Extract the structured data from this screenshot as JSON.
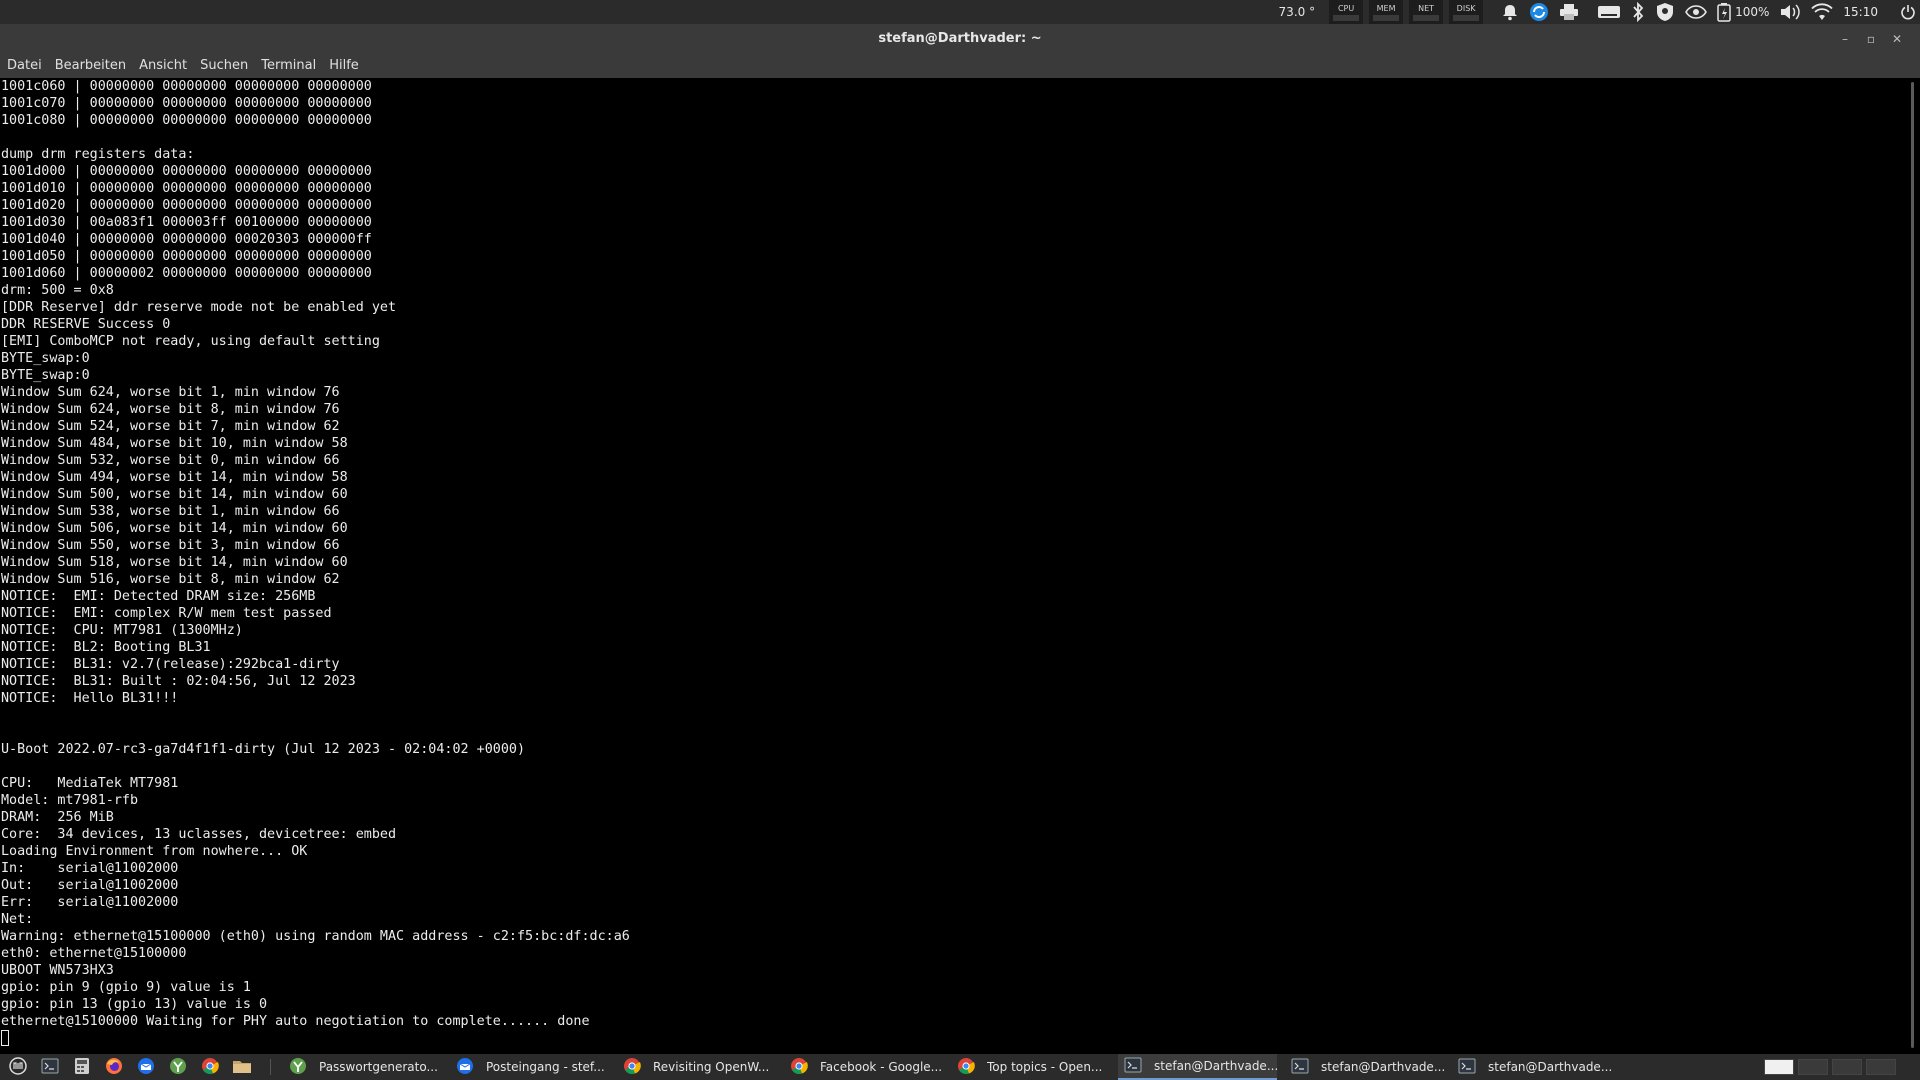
{
  "top_panel": {
    "temperature": "73.0 °",
    "monitors": [
      "CPU",
      "MEM",
      "NET",
      "DISK"
    ],
    "battery": "100%",
    "clock": "15:10"
  },
  "window": {
    "title": "stefan@Darthvader: ~"
  },
  "menu": [
    "Datei",
    "Bearbeiten",
    "Ansicht",
    "Suchen",
    "Terminal",
    "Hilfe"
  ],
  "terminal": {
    "lines": [
      "1001c060 | 00000000 00000000 00000000 00000000",
      "1001c070 | 00000000 00000000 00000000 00000000",
      "1001c080 | 00000000 00000000 00000000 00000000",
      "",
      "dump drm registers data:",
      "1001d000 | 00000000 00000000 00000000 00000000",
      "1001d010 | 00000000 00000000 00000000 00000000",
      "1001d020 | 00000000 00000000 00000000 00000000",
      "1001d030 | 00a083f1 000003ff 00100000 00000000",
      "1001d040 | 00000000 00000000 00020303 000000ff",
      "1001d050 | 00000000 00000000 00000000 00000000",
      "1001d060 | 00000002 00000000 00000000 00000000",
      "drm: 500 = 0x8",
      "[DDR Reserve] ddr reserve mode not be enabled yet",
      "DDR RESERVE Success 0",
      "[EMI] ComboMCP not ready, using default setting",
      "BYTE_swap:0",
      "BYTE_swap:0",
      "Window Sum 624, worse bit 1, min window 76",
      "Window Sum 624, worse bit 8, min window 76",
      "Window Sum 524, worse bit 7, min window 62",
      "Window Sum 484, worse bit 10, min window 58",
      "Window Sum 532, worse bit 0, min window 66",
      "Window Sum 494, worse bit 14, min window 58",
      "Window Sum 500, worse bit 14, min window 60",
      "Window Sum 538, worse bit 1, min window 66",
      "Window Sum 506, worse bit 14, min window 60",
      "Window Sum 550, worse bit 3, min window 66",
      "Window Sum 518, worse bit 14, min window 60",
      "Window Sum 516, worse bit 8, min window 62",
      "NOTICE:  EMI: Detected DRAM size: 256MB",
      "NOTICE:  EMI: complex R/W mem test passed",
      "NOTICE:  CPU: MT7981 (1300MHz)",
      "NOTICE:  BL2: Booting BL31",
      "NOTICE:  BL31: v2.7(release):292bca1-dirty",
      "NOTICE:  BL31: Built : 02:04:56, Jul 12 2023",
      "NOTICE:  Hello BL31!!!",
      "",
      "",
      "U-Boot 2022.07-rc3-ga7d4f1f1-dirty (Jul 12 2023 - 02:04:02 +0000)",
      "",
      "CPU:   MediaTek MT7981",
      "Model: mt7981-rfb",
      "DRAM:  256 MiB",
      "Core:  34 devices, 13 uclasses, devicetree: embed",
      "Loading Environment from nowhere... OK",
      "In:    serial@11002000",
      "Out:   serial@11002000",
      "Err:   serial@11002000",
      "Net:",
      "Warning: ethernet@15100000 (eth0) using random MAC address - c2:f5:bc:df:dc:a6",
      "eth0: ethernet@15100000",
      "UBOOT WN573HX3",
      "gpio: pin 9 (gpio 9) value is 1",
      "gpio: pin 13 (gpio 13) value is 0",
      "ethernet@15100000 Waiting for PHY auto negotiation to complete...... done"
    ]
  },
  "taskbar": {
    "launchers": [
      "menu-icon",
      "terminal-icon",
      "calculator-icon",
      "firefox-icon",
      "thunderbird-icon",
      "keepassxc-icon",
      "chrome-icon",
      "files-icon"
    ],
    "tasks": [
      {
        "label": "Passwortgenerato...",
        "icon": "keepassxc-icon",
        "active": false
      },
      {
        "label": "Posteingang - stef...",
        "icon": "thunderbird-icon",
        "active": false
      },
      {
        "label": "Revisiting OpenW...",
        "icon": "chrome-icon",
        "active": false
      },
      {
        "label": "Facebook - Google...",
        "icon": "chrome-icon",
        "active": false
      },
      {
        "label": "Top topics - Open...",
        "icon": "chrome-icon",
        "active": false
      },
      {
        "label": "stefan@Darthvade...",
        "icon": "terminal-icon",
        "active": true
      },
      {
        "label": "stefan@Darthvade...",
        "icon": "terminal-icon",
        "active": false
      },
      {
        "label": "stefan@Darthvade...",
        "icon": "terminal-icon",
        "active": false
      }
    ]
  },
  "colors": {
    "panel": "#2b2b2b",
    "titlebar": "#3a3a3a",
    "terminal_bg": "#000000",
    "terminal_fg": "#ececec",
    "active_task_accent": "#6f9bd1"
  }
}
